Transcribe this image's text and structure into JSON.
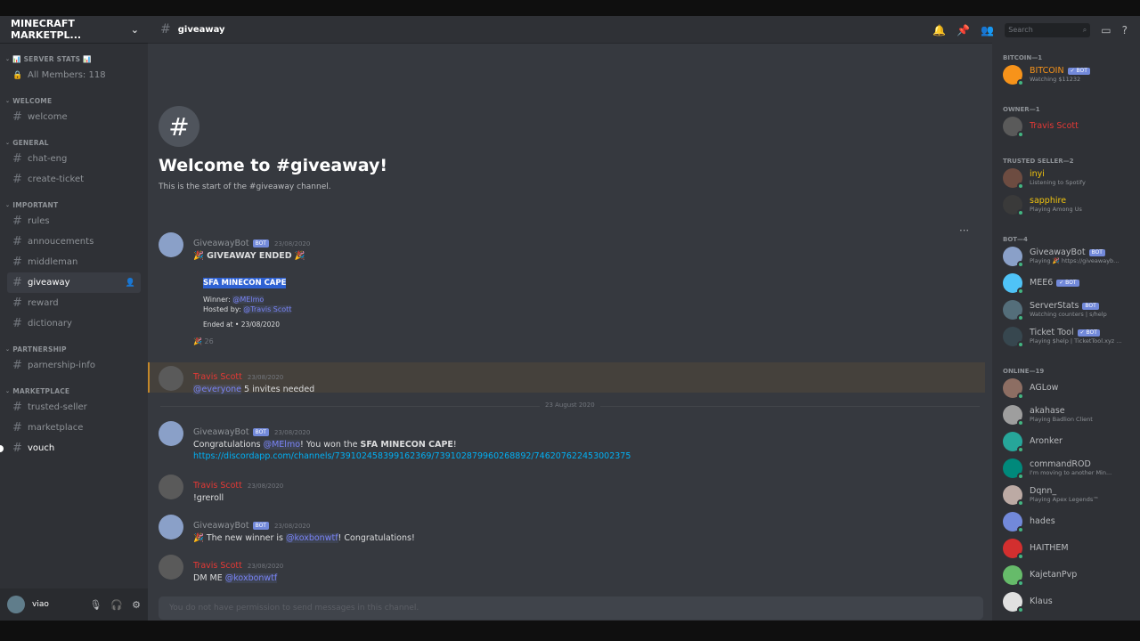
{
  "server": {
    "name": "MINECRAFT MARKETPL..."
  },
  "sidebar": {
    "sections": [
      {
        "title": "📊 SERVER STATS 📊",
        "channels": [
          {
            "name": "All Members: 118",
            "icon": "lock-icon"
          }
        ]
      },
      {
        "title": "WELCOME",
        "channels": [
          {
            "name": "welcome"
          }
        ]
      },
      {
        "title": "GENERAL",
        "channels": [
          {
            "name": "chat-eng"
          },
          {
            "name": "create-ticket"
          }
        ]
      },
      {
        "title": "IMPORTANT",
        "channels": [
          {
            "name": "rules"
          },
          {
            "name": "annoucements"
          },
          {
            "name": "middleman"
          },
          {
            "name": "giveaway"
          },
          {
            "name": "reward"
          },
          {
            "name": "dictionary"
          }
        ]
      },
      {
        "title": "PARTNERSHIP",
        "channels": [
          {
            "name": "parnership-info"
          }
        ]
      },
      {
        "title": "MARKETPLACE",
        "channels": [
          {
            "name": "trusted-seller"
          },
          {
            "name": "marketplace"
          },
          {
            "name": "vouch"
          }
        ]
      }
    ]
  },
  "user": {
    "name": "viao"
  },
  "header": {
    "channel": "giveaway",
    "search_placeholder": "Search"
  },
  "welcome": {
    "title": "Welcome to #giveaway!",
    "subtitle": "This is the start of the #giveaway channel."
  },
  "messages": {
    "m1": {
      "author": "GiveawayBot",
      "badge": "BOT",
      "time": "23/08/2020",
      "title": "🎉 GIVEAWAY ENDED 🎉",
      "prize": "SFA MINECON CAPE",
      "winner_label": "Winner: ",
      "winner": "@MElmo",
      "host_label": "Hosted by: ",
      "host": "@Travis Scott",
      "ended": "Ended at • 23/08/2020",
      "reaction": "🎉 26"
    },
    "m2": {
      "author": "Travis Scott",
      "time": "23/08/2020",
      "mention": "@everyone",
      "text": " 5 invites needed"
    },
    "divider": "23 August 2020",
    "m3": {
      "author": "GiveawayBot",
      "badge": "BOT",
      "time": "23/08/2020",
      "pre": "Congratulations ",
      "mention": "@MElmo",
      "mid": "! You won the ",
      "bold": "SFA MINECON CAPE",
      "post": "!",
      "link": "https://discordapp.com/channels/739102458399162369/739102879960268892/746207622453002375"
    },
    "m4": {
      "author": "Travis Scott",
      "time": "23/08/2020",
      "text": "!greroll"
    },
    "m5": {
      "author": "GiveawayBot",
      "badge": "BOT",
      "time": "23/08/2020",
      "pre": "🎉 The new winner is ",
      "mention": "@koxbonwtf",
      "post": "! Congratulations!"
    },
    "m6": {
      "author": "Travis Scott",
      "time": "23/08/2020",
      "pre": "DM ME ",
      "mention": "@koxbonwtf"
    }
  },
  "input": {
    "placeholder": "You do not have permission to send messages in this channel."
  },
  "members": {
    "groups": [
      {
        "title": "BITCOIN—1",
        "items": [
          {
            "name": "BITCOIN",
            "color": "#f7931a",
            "badge": "✓ BOT",
            "activity": "Watching $11232",
            "avatar": "#f7931a"
          }
        ]
      },
      {
        "title": "OWNER—1",
        "items": [
          {
            "name": "Travis Scott",
            "color": "#e53935",
            "activity": "",
            "avatar": "#5a5a5a"
          }
        ]
      },
      {
        "title": "TRUSTED SELLER—2",
        "items": [
          {
            "name": "inyi",
            "color": "#f1c40f",
            "activity": "Listening to Spotify",
            "avatar": "#6d4c41"
          },
          {
            "name": "sapphire",
            "color": "#f1c40f",
            "activity": "Playing Among Us",
            "avatar": "#3a3a3a"
          }
        ]
      },
      {
        "title": "BOT—4",
        "items": [
          {
            "name": "GiveawayBot",
            "color": "#b9bbbe",
            "badge": "BOT",
            "activity": "Playing 🎉 https://giveawayb...",
            "avatar": "#8aa0c8"
          },
          {
            "name": "MEE6",
            "color": "#b9bbbe",
            "badge": "✓ BOT",
            "activity": "",
            "avatar": "#4fc3f7"
          },
          {
            "name": "ServerStats",
            "color": "#b9bbbe",
            "badge": "BOT",
            "activity": "Watching counters | s/help",
            "avatar": "#546e7a"
          },
          {
            "name": "Ticket Tool",
            "color": "#b9bbbe",
            "badge": "✓ BOT",
            "activity": "Playing $help | TicketTool.xyz ...",
            "avatar": "#37474f"
          }
        ]
      },
      {
        "title": "ONLINE—19",
        "items": [
          {
            "name": "AGLow",
            "color": "#b9bbbe",
            "activity": "",
            "avatar": "#8d6e63"
          },
          {
            "name": "akahase",
            "color": "#b9bbbe",
            "activity": "Playing Badlion Client",
            "avatar": "#9e9e9e"
          },
          {
            "name": "Aronker",
            "color": "#b9bbbe",
            "activity": "",
            "avatar": "#26a69a"
          },
          {
            "name": "commandROD",
            "color": "#b9bbbe",
            "activity": "I'm moving to another Min...",
            "avatar": "#00897b"
          },
          {
            "name": "Dqnn_",
            "color": "#b9bbbe",
            "activity": "Playing Apex Legends™",
            "avatar": "#bcaaa4"
          },
          {
            "name": "hades",
            "color": "#b9bbbe",
            "activity": "",
            "avatar": "#7289da"
          },
          {
            "name": "HAITHEM",
            "color": "#b9bbbe",
            "activity": "",
            "avatar": "#d32f2f"
          },
          {
            "name": "KajetanPvp",
            "color": "#b9bbbe",
            "activity": "",
            "avatar": "#66bb6a"
          },
          {
            "name": "Klaus",
            "color": "#b9bbbe",
            "activity": "",
            "avatar": "#e0e0e0"
          }
        ]
      }
    ]
  }
}
